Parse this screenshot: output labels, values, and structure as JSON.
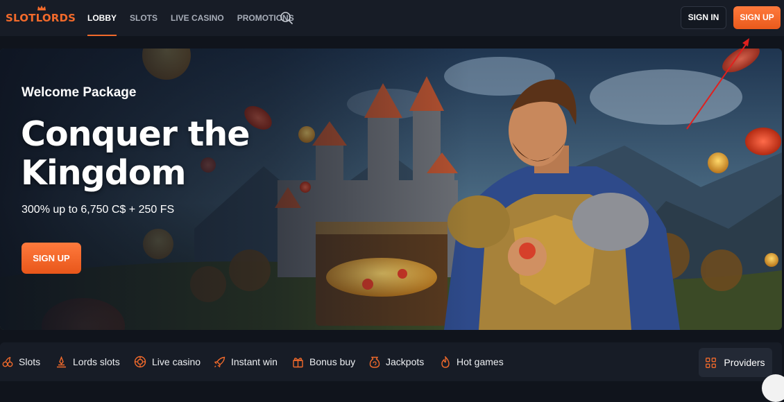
{
  "logo": {
    "text": "SLOTLORDS"
  },
  "nav": {
    "items": [
      {
        "label": "LOBBY",
        "active": true
      },
      {
        "label": "SLOTS"
      },
      {
        "label": "LIVE CASINO"
      },
      {
        "label": "PROMOTIONS"
      }
    ],
    "search_icon": "search-icon"
  },
  "auth": {
    "signin_label": "SIGN IN",
    "signup_label": "SIGN UP"
  },
  "hero": {
    "kicker": "Welcome Package",
    "headline": "Conquer the Kingdom",
    "offer": "300% up to 6,750 C$ + 250 FS",
    "cta_label": "SIGN UP"
  },
  "categories": [
    {
      "label": "Slots",
      "icon": "cherries-icon"
    },
    {
      "label": "Lords slots",
      "icon": "crown-icon"
    },
    {
      "label": "Live casino",
      "icon": "chip-icon"
    },
    {
      "label": "Instant win",
      "icon": "rocket-icon"
    },
    {
      "label": "Bonus buy",
      "icon": "gift-icon"
    },
    {
      "label": "Jackpots",
      "icon": "money-bag-icon"
    },
    {
      "label": "Hot games",
      "icon": "flame-icon"
    }
  ],
  "providers": {
    "label": "Providers",
    "icon": "grid-icon"
  },
  "colors": {
    "accent": "#f26a2b",
    "header_bg": "#171c26",
    "page_bg": "#10141c",
    "annotation_arrow": "#e0201e"
  }
}
